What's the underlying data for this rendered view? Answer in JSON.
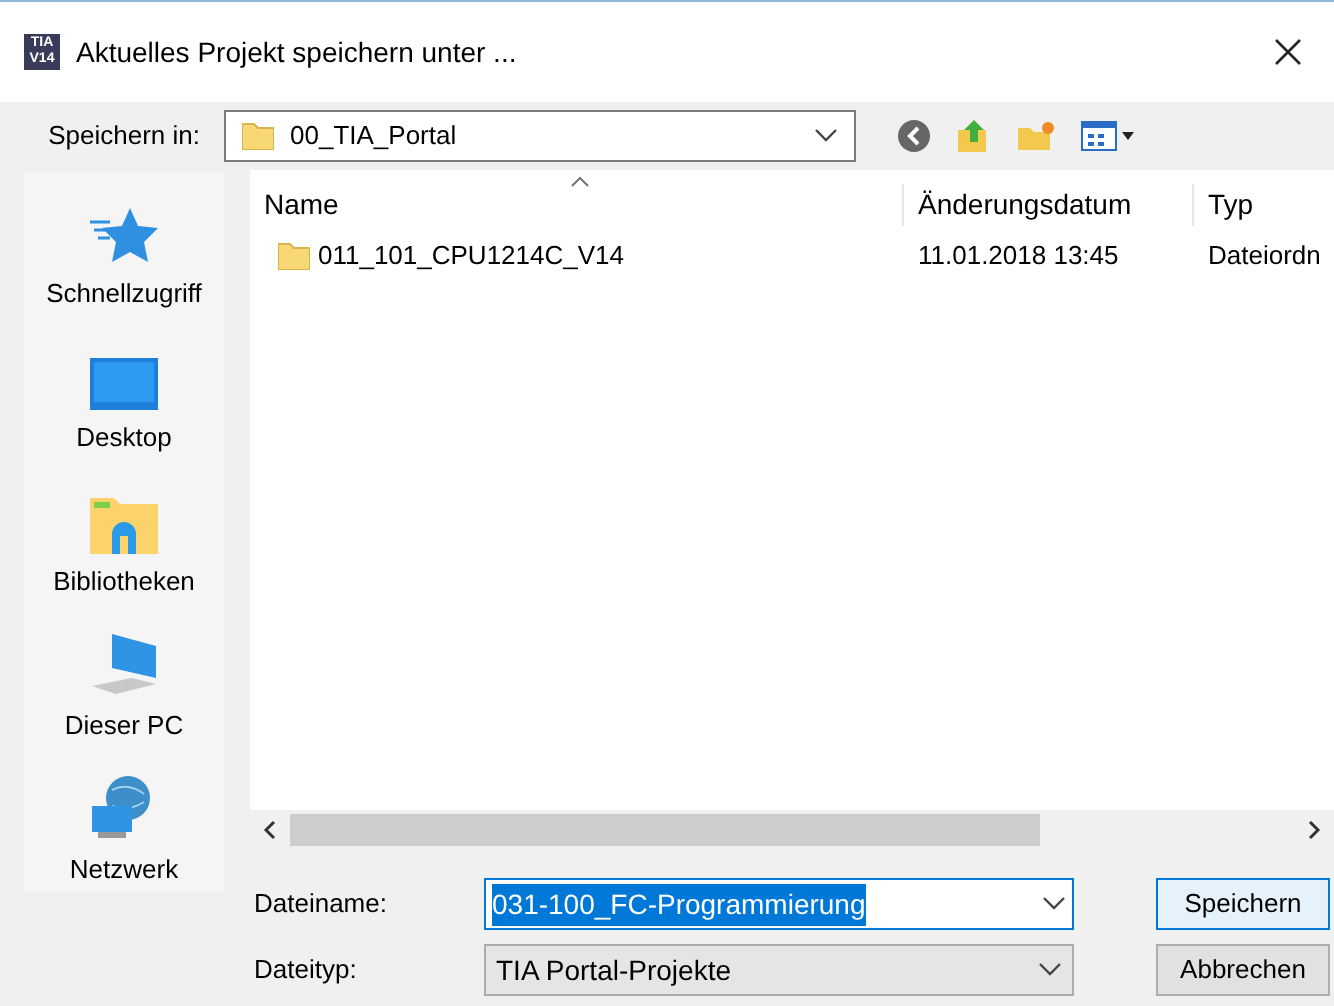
{
  "window": {
    "title": "Aktuelles Projekt speichern unter ...",
    "app_icon": "TIA V14"
  },
  "location": {
    "label": "Speichern in:",
    "value": "00_TIA_Portal"
  },
  "places": [
    {
      "label": "Schnellzugriff",
      "kind": "star"
    },
    {
      "label": "Desktop",
      "kind": "desktop"
    },
    {
      "label": "Bibliotheken",
      "kind": "library"
    },
    {
      "label": "Dieser PC",
      "kind": "pc"
    },
    {
      "label": "Netzwerk",
      "kind": "network"
    }
  ],
  "table": {
    "columns": [
      "Name",
      "Änderungsdatum",
      "Typ"
    ],
    "rows": [
      {
        "name": "011_101_CPU1214C_V14",
        "date": "11.01.2018 13:45",
        "type": "Dateiordn"
      }
    ]
  },
  "filename": {
    "label": "Dateiname:",
    "value": "031-100_FC-Programmierung"
  },
  "filetype": {
    "label": "Dateityp:",
    "value": "TIA Portal-Projekte"
  },
  "buttons": [
    "Speichern",
    "Abbrechen"
  ]
}
